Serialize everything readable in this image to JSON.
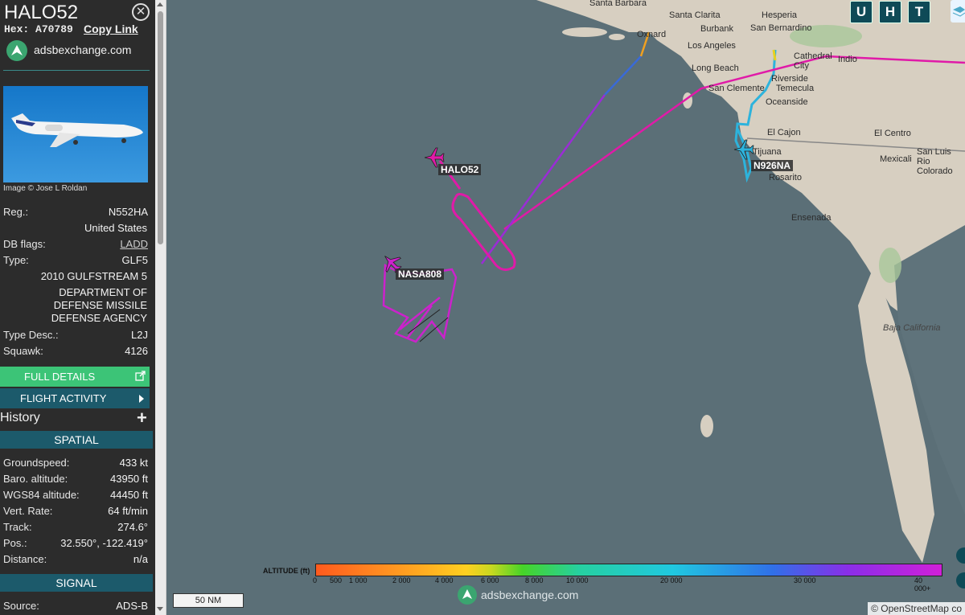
{
  "aircraft": {
    "callsign": "HALO52",
    "hex_label": "Hex:",
    "hex": "A70789",
    "copy_link": "Copy Link",
    "brand": "adsbexchange.com",
    "image_credit": "Image © Jose L Roldan",
    "reg_label": "Reg.:",
    "reg": "N552HA",
    "country": "United States",
    "dbflags_label": "DB flags:",
    "dbflags": "LADD",
    "type_label": "Type:",
    "type": "GLF5",
    "model": "2010 GULFSTREAM 5",
    "operator_lines": [
      "DEPARTMENT OF",
      "DEFENSE MISSILE",
      "DEFENSE AGENCY"
    ],
    "typedesc_label": "Type Desc.:",
    "typedesc": "L2J",
    "squawk_label": "Squawk:",
    "squawk": "4126"
  },
  "buttons": {
    "full_details": "FULL DETAILS",
    "flight_activity": "FLIGHT ACTIVITY",
    "history": "History"
  },
  "spatial": {
    "heading": "SPATIAL",
    "rows": [
      {
        "label": "Groundspeed:",
        "value": "433 kt"
      },
      {
        "label": "Baro. altitude:",
        "value": "43950 ft"
      },
      {
        "label": "WGS84 altitude:",
        "value": "44450 ft"
      },
      {
        "label": "Vert. Rate:",
        "value": "64 ft/min"
      },
      {
        "label": "Track:",
        "value": "274.6°"
      },
      {
        "label": "Pos.:",
        "value": "32.550°, -122.419°"
      },
      {
        "label": "Distance:",
        "value": "n/a"
      }
    ]
  },
  "signal": {
    "heading": "SIGNAL",
    "source_label": "Source:",
    "source": "ADS-B"
  },
  "map": {
    "hud_buttons": [
      "U",
      "H",
      "T"
    ],
    "labels": {
      "halo52": "HALO52",
      "nasa808": "NASA808",
      "n926na": "N926NA"
    },
    "cities": [
      "Santa Barbara",
      "Santa Clarita",
      "Hesperia",
      "Burbank",
      "San Bernardino",
      "Oxnard",
      "Los Angeles",
      "Long Beach",
      "Cathedral City",
      "Indio",
      "Riverside",
      "San Clemente",
      "Temecula",
      "Oceanside",
      "El Cajon",
      "El Centro",
      "Tijuana",
      "Mexicali",
      "San Luis Rio Colorado",
      "Rosarito",
      "Ensenada",
      "Baja California"
    ],
    "scale": "50 NM",
    "attribution": "© OpenStreetMap co",
    "brand": "adsbexchange.com",
    "colors": {
      "halo52": "#e01aa8",
      "nasa808": "#cc22cc",
      "n926na": "#22b0d8",
      "ocean": "#5b6f77",
      "land": "#d8d0c2"
    }
  },
  "legend": {
    "title": "ALTITUDE (ft)",
    "ticks": [
      "0",
      "500",
      "1 000",
      "2 000",
      "4 000",
      "6 000",
      "8 000",
      "10 000",
      "20 000",
      "30 000",
      "40 000+"
    ]
  }
}
